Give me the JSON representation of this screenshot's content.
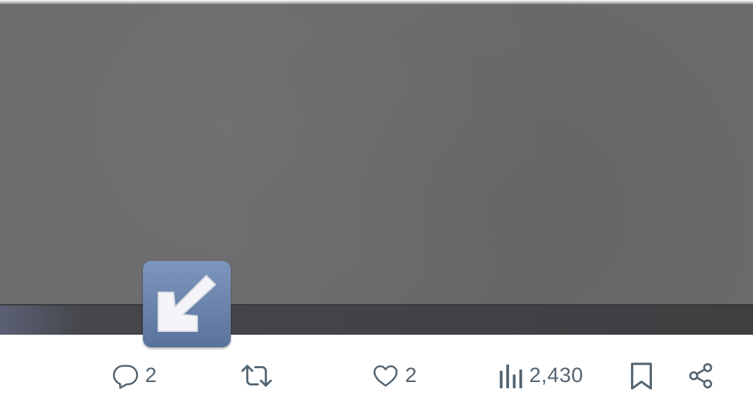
{
  "post_media": {
    "emoji": "↙️"
  },
  "action_bar": {
    "reply": {
      "icon": "reply-bubble-icon",
      "count": "2"
    },
    "repost": {
      "icon": "repost-icon",
      "count": ""
    },
    "like": {
      "icon": "heart-icon",
      "count": "2"
    },
    "views": {
      "icon": "bar-chart-icon",
      "count": "2,430"
    },
    "bookmark": {
      "icon": "bookmark-icon"
    },
    "share": {
      "icon": "share-icon"
    }
  },
  "colors": {
    "icon_gray": "#536471",
    "media_gray": "#6b6b6d",
    "ledge_dark": "#3f3f42",
    "emoji_blue": "#6b85ad"
  }
}
